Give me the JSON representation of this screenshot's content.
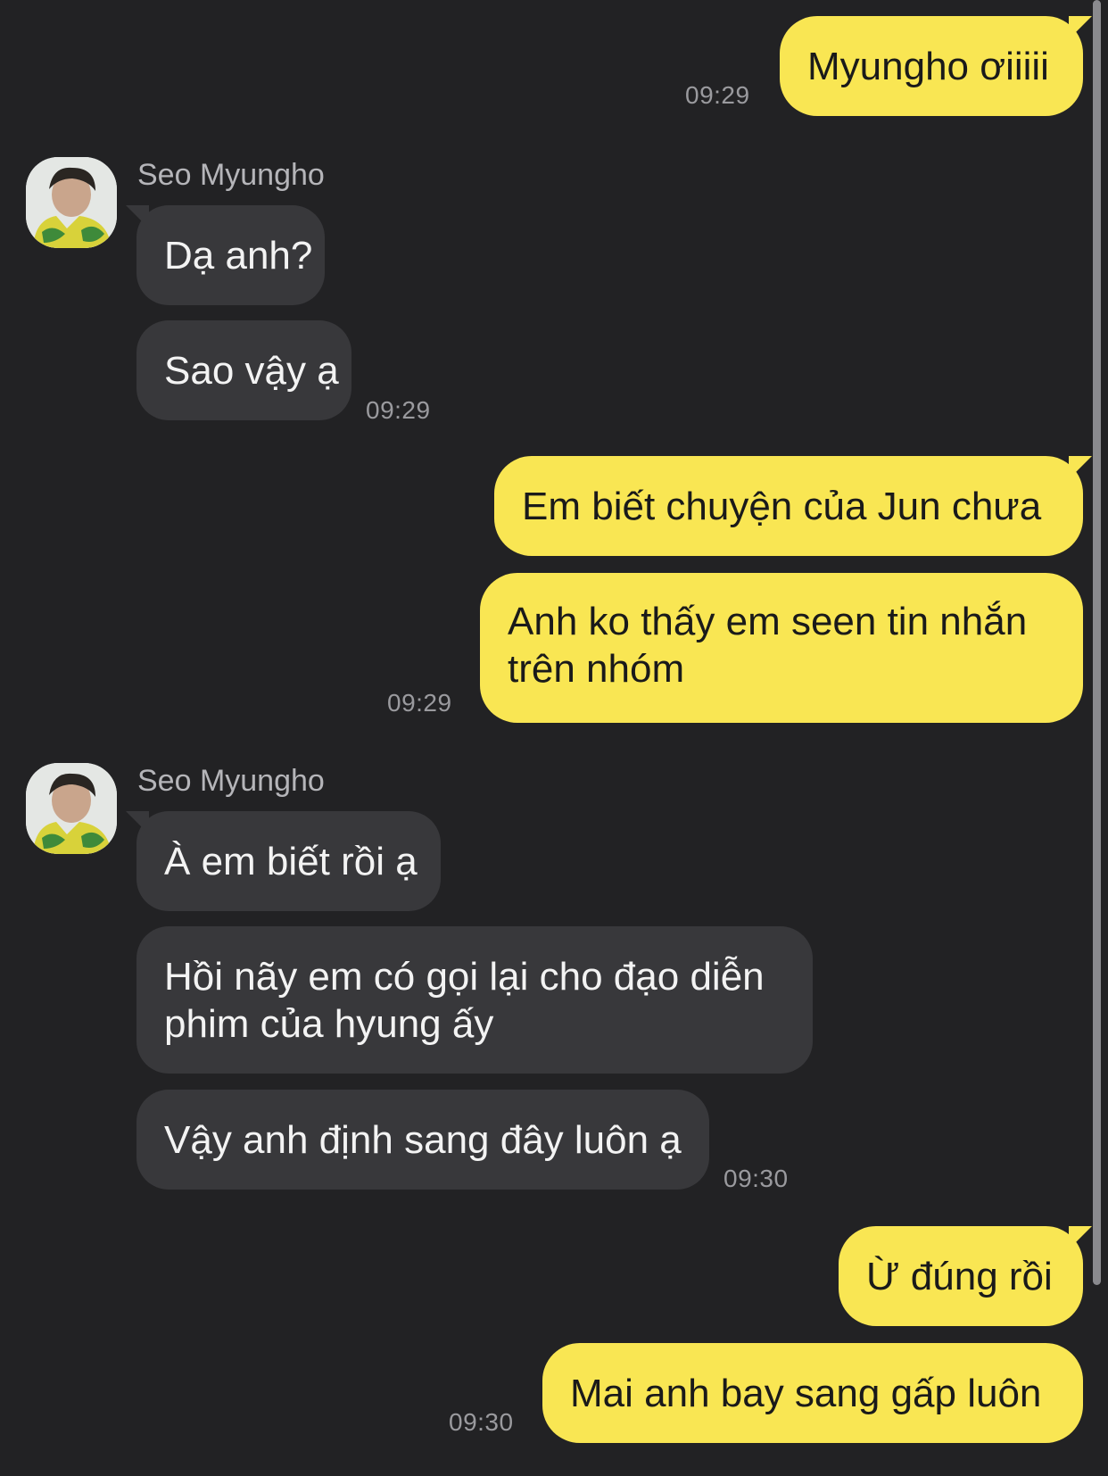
{
  "messages": [
    {
      "text": "Myungho ơiiiii"
    },
    {
      "sender": "Seo Myungho"
    },
    {
      "text": "Dạ anh?"
    },
    {
      "text": "Sao vậy ạ"
    },
    {
      "text": "Em biết chuyện của Jun chưa"
    },
    {
      "text": "Anh ko thấy em seen tin nhắn trên nhóm"
    },
    {
      "sender": "Seo Myungho"
    },
    {
      "text": "À em biết rồi ạ"
    },
    {
      "text": "Hồi nãy em có gọi lại cho đạo diễn phim của hyung ấy"
    },
    {
      "text": "Vậy anh định sang đây luôn ạ"
    },
    {
      "text": "Ừ đúng rồi"
    },
    {
      "text": "Mai anh bay sang gấp luôn"
    }
  ],
  "times": {
    "t1": "09:29",
    "t2": "09:29",
    "t3": "09:29",
    "t4": "09:30",
    "t5": "09:30"
  },
  "colors": {
    "background": "#222224",
    "outgoing_bubble": "#f9e653",
    "incoming_bubble": "#38383b",
    "timestamp": "#9a9a9e"
  }
}
